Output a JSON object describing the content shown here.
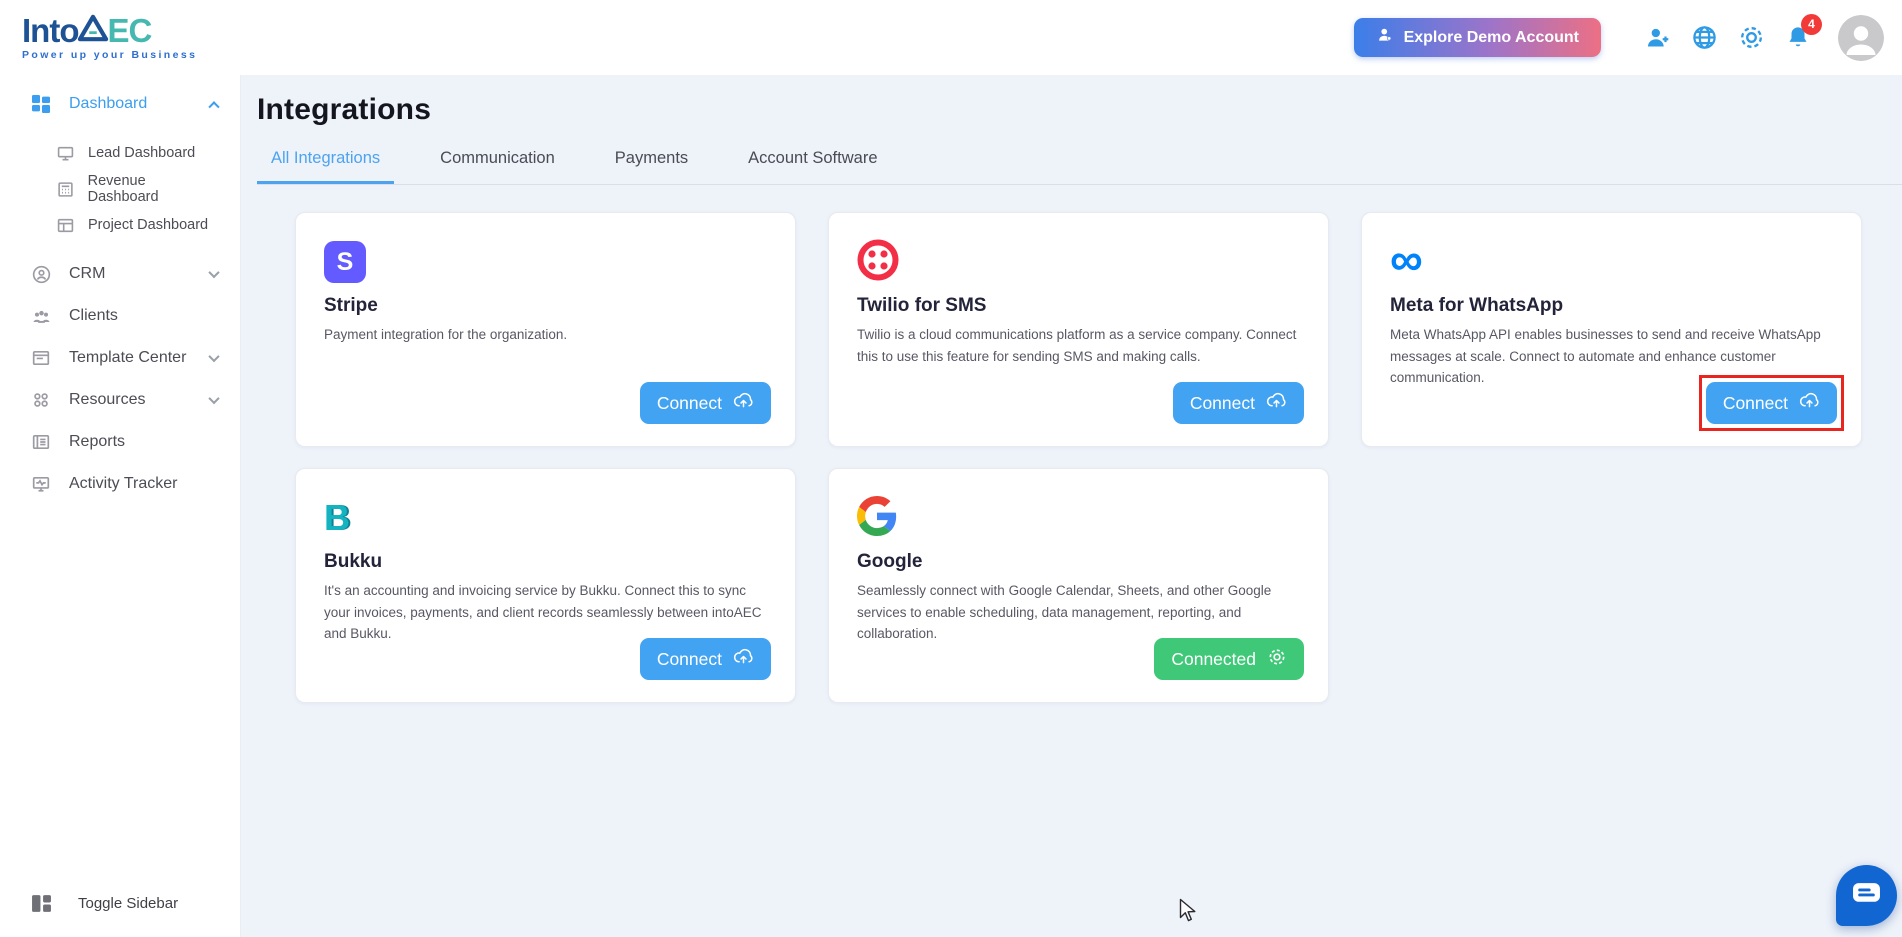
{
  "brand": {
    "title_primary": "Into",
    "title_secondary": "EC",
    "tagline": "Power up your Business"
  },
  "header": {
    "explore_button": "Explore Demo Account",
    "notification_count": "4"
  },
  "sidebar": {
    "items": [
      {
        "label": "Dashboard",
        "active": true,
        "expanded": true
      },
      {
        "label": "CRM",
        "expandable": true
      },
      {
        "label": "Clients"
      },
      {
        "label": "Template Center",
        "expandable": true
      },
      {
        "label": "Resources",
        "expandable": true
      },
      {
        "label": "Reports"
      },
      {
        "label": "Activity Tracker"
      }
    ],
    "dashboard_sub_items": [
      {
        "label": "Lead Dashboard"
      },
      {
        "label": "Revenue Dashboard"
      },
      {
        "label": "Project Dashboard"
      }
    ],
    "toggle_label": "Toggle Sidebar"
  },
  "page": {
    "title": "Integrations"
  },
  "tabs": [
    {
      "label": "All Integrations",
      "active": true
    },
    {
      "label": "Communication"
    },
    {
      "label": "Payments"
    },
    {
      "label": "Account Software"
    }
  ],
  "cards": [
    {
      "name": "Stripe",
      "icon_letter": "S",
      "description": "Payment integration for the organization.",
      "button": "Connect",
      "status": "not_connected"
    },
    {
      "name": "Twilio for SMS",
      "description": "Twilio is a cloud communications platform as a service company. Connect this to use this feature for sending SMS and making calls.",
      "button": "Connect",
      "status": "not_connected"
    },
    {
      "name": "Meta for WhatsApp",
      "icon_glyph": "∞",
      "description": "Meta WhatsApp API enables businesses to send and receive WhatsApp messages at scale. Connect to automate and enhance customer communication.",
      "button": "Connect",
      "status": "not_connected",
      "highlighted": true
    },
    {
      "name": "Bukku",
      "icon_letter": "B",
      "description": "It's an accounting and invoicing service by Bukku. Connect this to sync your invoices, payments, and client records seamlessly between intoAEC and Bukku.",
      "button": "Connect",
      "status": "not_connected"
    },
    {
      "name": "Google",
      "description": "Seamlessly connect with Google Calendar, Sheets, and other Google services to enable scheduling, data management, reporting, and collaboration.",
      "button": "Connected",
      "status": "connected"
    }
  ],
  "colors": {
    "accent_blue": "#42a3f2",
    "sidebar_active_blue": "#3b9ef0",
    "connected_green": "#3ec878",
    "badge_red": "#f23b38",
    "highlight_red": "#e8251f",
    "demo_gradient_start": "#3b7ee9",
    "demo_gradient_end": "#ec7085",
    "chat_blue": "#1266d1",
    "stripe_purple": "#635bff",
    "twilio_red": "#f22f46",
    "meta_blue": "#0082fb",
    "bukku_teal": "#14b3c0",
    "logo_navy": "#1d5394",
    "logo_teal": "#45b8b0",
    "main_background": "#eef2f9"
  }
}
